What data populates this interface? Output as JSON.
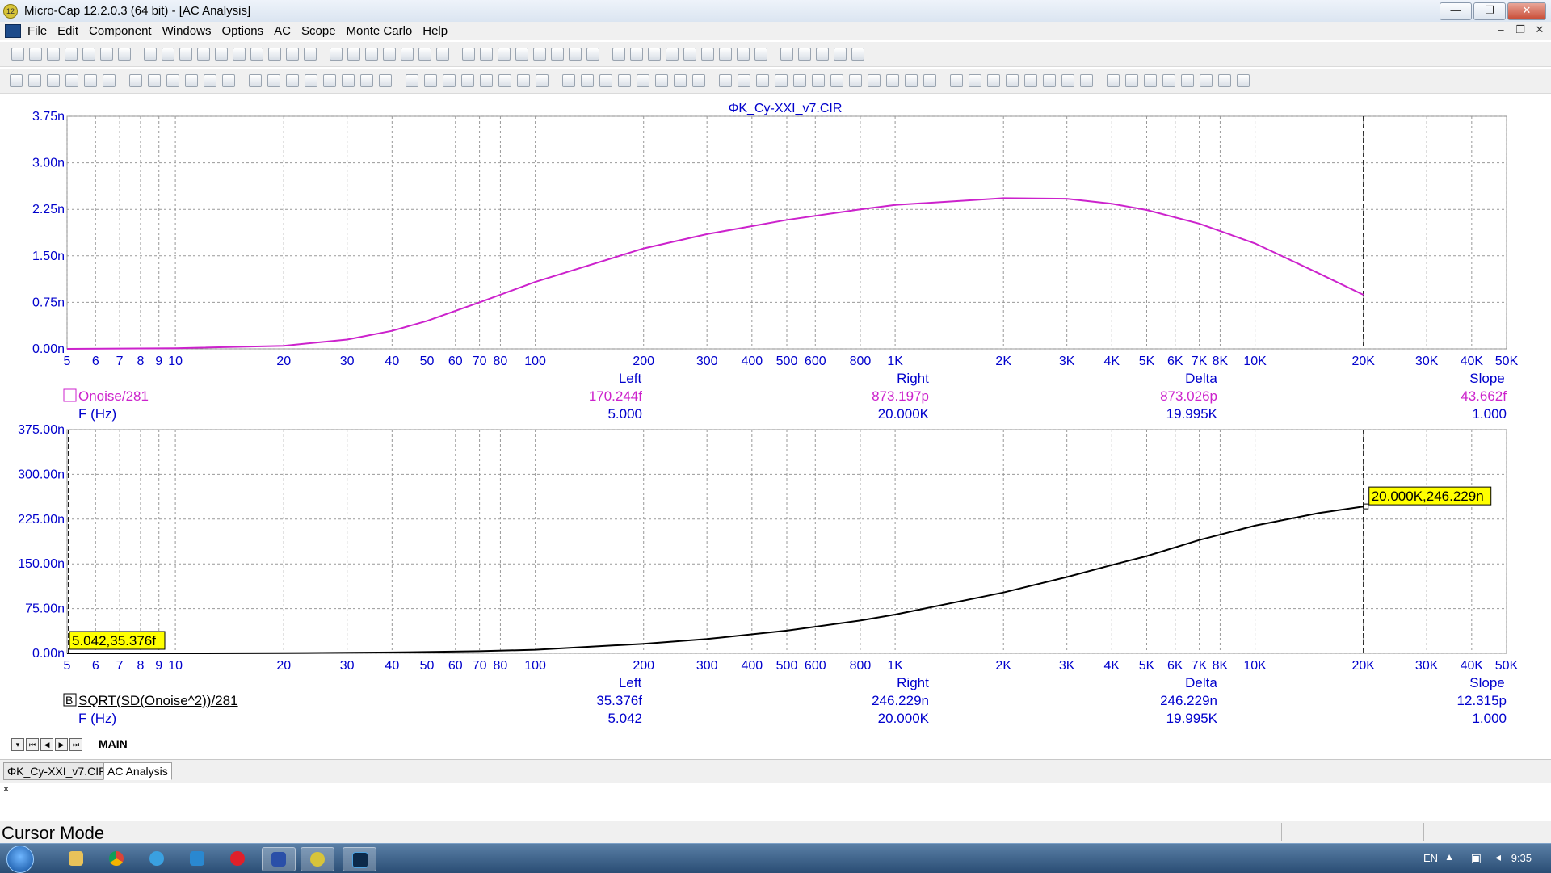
{
  "window": {
    "title": "Micro-Cap 12.2.0.3 (64 bit) - [AC Analysis]",
    "controls": [
      "—",
      "❐",
      "✕"
    ]
  },
  "menu": {
    "items": [
      "File",
      "Edit",
      "Component",
      "Windows",
      "Options",
      "AC",
      "Scope",
      "Monte Carlo",
      "Help"
    ],
    "mdi_controls": [
      "–",
      "❐",
      "✕"
    ]
  },
  "plot_title": "ΦK_Cy-XXI_v7.CIR",
  "x_tick_labels": [
    "5",
    "6",
    "7",
    "8",
    "9",
    "10",
    "20",
    "30",
    "40",
    "50",
    "60",
    "70",
    "80",
    "100",
    "200",
    "300",
    "400",
    "500",
    "600",
    "800",
    "1K",
    "2K",
    "3K",
    "4K",
    "5K",
    "6K",
    "7K",
    "8K",
    "10K",
    "20K",
    "30K",
    "40K",
    "50K"
  ],
  "cursor_table_headers": {
    "left": "Left",
    "right": "Right",
    "delta": "Delta",
    "slope": "Slope"
  },
  "chart_data": [
    {
      "type": "line",
      "xscale": "log",
      "xlim": [
        5,
        50000
      ],
      "ylim": [
        0,
        3.75e-09
      ],
      "y_tick_labels": [
        "3.75n",
        "3.00n",
        "2.25n",
        "1.50n",
        "0.75n",
        "0.00n"
      ],
      "grid": true,
      "series": [
        {
          "name": "Onoise/281",
          "color": "#cc22cc",
          "x": [
            5,
            10,
            20,
            30,
            40,
            50,
            70,
            100,
            200,
            300,
            500,
            800,
            1000,
            2000,
            3000,
            4000,
            5000,
            7000,
            10000,
            15000,
            20000
          ],
          "y": [
            1.7e-13,
            1e-11,
            5e-11,
            1.5e-10,
            2.9e-10,
            4.5e-10,
            7.5e-10,
            1.08e-09,
            1.62e-09,
            1.85e-09,
            2.08e-09,
            2.25e-09,
            2.32e-09,
            2.43e-09,
            2.42e-09,
            2.34e-09,
            2.24e-09,
            2.02e-09,
            1.7e-09,
            1.22e-09,
            8.73e-10
          ]
        }
      ],
      "x_variable": "F (Hz)",
      "cursor_values": {
        "left": "170.244f",
        "right": "873.197p",
        "delta": "873.026p",
        "slope": "43.662f"
      },
      "x_cursor_values": {
        "left": "5.000",
        "right": "20.000K",
        "delta": "19.995K",
        "slope": "1.000"
      }
    },
    {
      "type": "line",
      "xscale": "log",
      "xlim": [
        5,
        50000
      ],
      "ylim": [
        0,
        3.75e-07
      ],
      "y_tick_labels": [
        "375.00n",
        "300.00n",
        "225.00n",
        "150.00n",
        "75.00n",
        "0.00n"
      ],
      "grid": true,
      "series": [
        {
          "name": "SQRT(SD(Onoise^2))/281",
          "color": "#000000",
          "x": [
            5,
            10,
            20,
            40,
            70,
            100,
            200,
            300,
            500,
            800,
            1000,
            2000,
            3000,
            4000,
            5000,
            7000,
            10000,
            15000,
            20000
          ],
          "y": [
            3.5e-14,
            5e-11,
            3e-10,
            1.5e-09,
            3.5e-09,
            6e-09,
            1.6e-08,
            2.4e-08,
            3.8e-08,
            5.5e-08,
            6.5e-08,
            1.02e-07,
            1.28e-07,
            1.48e-07,
            1.63e-07,
            1.9e-07,
            2.14e-07,
            2.35e-07,
            2.46e-07
          ]
        }
      ],
      "x_variable": "F (Hz)",
      "cursor_values": {
        "left": "35.376f",
        "right": "246.229n",
        "delta": "246.229n",
        "slope": "12.315p"
      },
      "x_cursor_values": {
        "left": "5.042",
        "right": "20.000K",
        "delta": "19.995K",
        "slope": "1.000"
      },
      "annotations": {
        "left_tag": "5.042,35.376f",
        "right_tag": "20.000K,246.229n"
      }
    }
  ],
  "bottom_tabs": {
    "main": "MAIN"
  },
  "doc_tabs": [
    "ΦK_Cy-XXI_v7.CIR",
    "AC Analysis"
  ],
  "output_close": "×",
  "status": {
    "mode": "Cursor Mode"
  },
  "taskbar": {
    "language": "EN",
    "time": "9:35"
  },
  "colors": {
    "axis_text": "#0000cc",
    "grid": "#999999",
    "trace1": "#cc22cc",
    "trace2": "#000000",
    "tag_bg": "#ffff00"
  }
}
